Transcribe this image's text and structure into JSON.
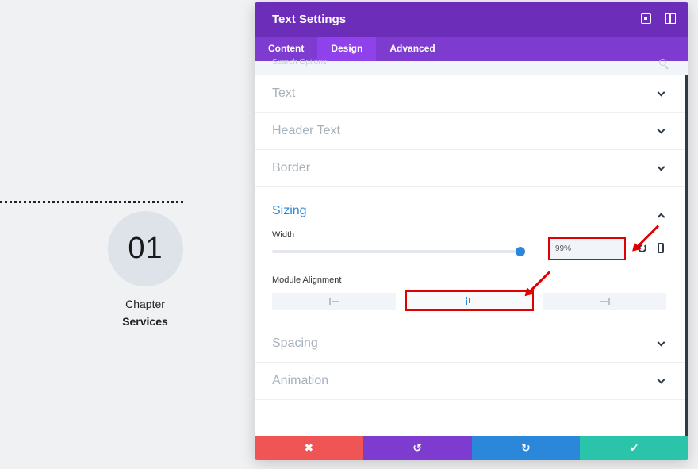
{
  "canvas": {
    "chapter_number": "01",
    "chapter_label": "Chapter",
    "chapter_sub": "Services"
  },
  "modal": {
    "title": "Text Settings",
    "tabs": [
      {
        "label": "Content",
        "active": false
      },
      {
        "label": "Design",
        "active": true
      },
      {
        "label": "Advanced",
        "active": false
      }
    ],
    "search_placeholder": "Search Options",
    "sections_top": [
      {
        "label": "Text"
      },
      {
        "label": "Header Text"
      },
      {
        "label": "Border"
      }
    ],
    "sizing": {
      "title": "Sizing",
      "width_label": "Width",
      "width_value": "99%",
      "width_level": 0.99,
      "alignment_label": "Module Alignment",
      "alignment_selected": "center"
    },
    "sections_bottom": [
      {
        "label": "Spacing"
      },
      {
        "label": "Animation"
      }
    ],
    "footer": {
      "cancel_glyph": "✖",
      "undo_glyph": "↺",
      "redo_glyph": "↻",
      "save_glyph": "✔"
    }
  },
  "colors": {
    "header": "#6c2eb9",
    "tabs": "#7e3bd0",
    "accent": "#2b87da",
    "cancel": "#ef5555",
    "save": "#29c4a9",
    "highlight": "#e00000"
  }
}
